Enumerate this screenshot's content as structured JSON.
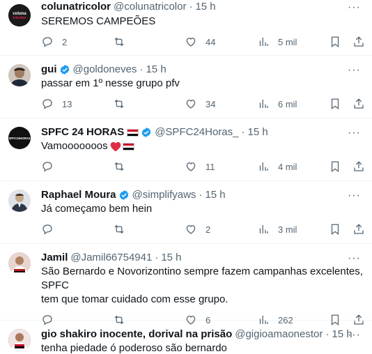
{
  "tweets": [
    {
      "name": "colunatricolor",
      "handle": "@colunatricolor",
      "time": "15 h",
      "text": "SEREMOS CAMPEÕES",
      "replies": "2",
      "retweets": "",
      "likes": "44",
      "views": "5 mil",
      "avatar_label": "coluna tricolor",
      "avatar_color": "#1a1a1a"
    },
    {
      "name": "gui",
      "handle": "@goldoneves",
      "time": "15 h",
      "text": "passar em 1º nesse grupo pfv",
      "replies": "13",
      "retweets": "",
      "likes": "34",
      "views": "6 mil",
      "avatar_color": "#5a4a3f"
    },
    {
      "name": "SPFC 24 HORAS",
      "handle": "@SPFC24Horas_",
      "time": "15 h",
      "text": "Vamooooooos",
      "replies": "",
      "retweets": "",
      "likes": "11",
      "views": "4 mil",
      "avatar_label": "SPFC24HORAS",
      "avatar_color": "#111111"
    },
    {
      "name": "Raphael Moura",
      "handle": "@simplifyaws",
      "time": "15 h",
      "text": "Já começamo bem hein",
      "replies": "",
      "retweets": "",
      "likes": "2",
      "views": "3 mil",
      "avatar_color": "#6b7280"
    },
    {
      "name": "Jamil",
      "handle": "@Jamil66754941",
      "time": "15 h",
      "text_line1": "São Bernardo e Novorizontino sempre fazem campanhas excelentes, SPFC",
      "text_line2": "tem que tomar cuidado com esse grupo.",
      "replies": "",
      "retweets": "",
      "likes": "6",
      "views": "262",
      "avatar_color": "#b91c1c"
    },
    {
      "name": "gio shakiro inocente, dorival na prisão",
      "handle": "@gigioamaonestor",
      "time": "15 h",
      "text": "tenha piedade ó poderoso são bernardo",
      "avatar_color": "#9f1239"
    }
  ],
  "colors": {
    "verified": "#1d9bf0",
    "muted": "#536471",
    "divider": "#eff3f4",
    "flag_red": "#ce1126",
    "flag_white": "#ffffff",
    "flag_black": "#000000"
  }
}
